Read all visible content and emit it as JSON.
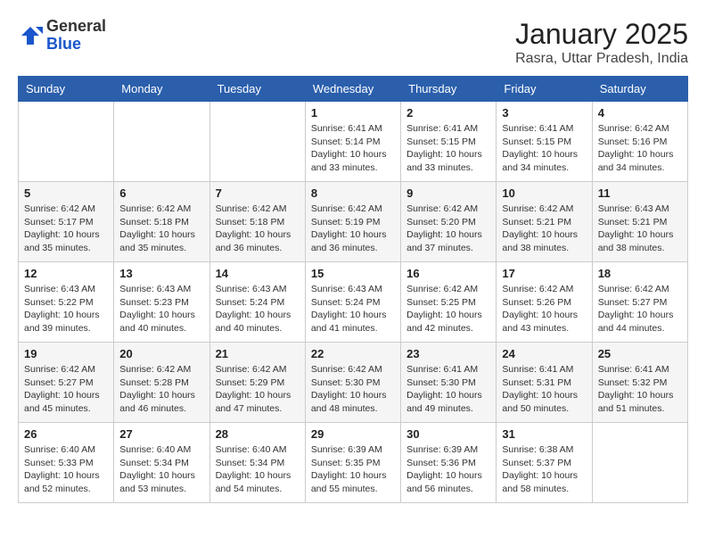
{
  "logo": {
    "general": "General",
    "blue": "Blue"
  },
  "header": {
    "month": "January 2025",
    "location": "Rasra, Uttar Pradesh, India"
  },
  "weekdays": [
    "Sunday",
    "Monday",
    "Tuesday",
    "Wednesday",
    "Thursday",
    "Friday",
    "Saturday"
  ],
  "weeks": [
    [
      {
        "day": "",
        "content": ""
      },
      {
        "day": "",
        "content": ""
      },
      {
        "day": "",
        "content": ""
      },
      {
        "day": "1",
        "content": "Sunrise: 6:41 AM\nSunset: 5:14 PM\nDaylight: 10 hours\nand 33 minutes."
      },
      {
        "day": "2",
        "content": "Sunrise: 6:41 AM\nSunset: 5:15 PM\nDaylight: 10 hours\nand 33 minutes."
      },
      {
        "day": "3",
        "content": "Sunrise: 6:41 AM\nSunset: 5:15 PM\nDaylight: 10 hours\nand 34 minutes."
      },
      {
        "day": "4",
        "content": "Sunrise: 6:42 AM\nSunset: 5:16 PM\nDaylight: 10 hours\nand 34 minutes."
      }
    ],
    [
      {
        "day": "5",
        "content": "Sunrise: 6:42 AM\nSunset: 5:17 PM\nDaylight: 10 hours\nand 35 minutes."
      },
      {
        "day": "6",
        "content": "Sunrise: 6:42 AM\nSunset: 5:18 PM\nDaylight: 10 hours\nand 35 minutes."
      },
      {
        "day": "7",
        "content": "Sunrise: 6:42 AM\nSunset: 5:18 PM\nDaylight: 10 hours\nand 36 minutes."
      },
      {
        "day": "8",
        "content": "Sunrise: 6:42 AM\nSunset: 5:19 PM\nDaylight: 10 hours\nand 36 minutes."
      },
      {
        "day": "9",
        "content": "Sunrise: 6:42 AM\nSunset: 5:20 PM\nDaylight: 10 hours\nand 37 minutes."
      },
      {
        "day": "10",
        "content": "Sunrise: 6:42 AM\nSunset: 5:21 PM\nDaylight: 10 hours\nand 38 minutes."
      },
      {
        "day": "11",
        "content": "Sunrise: 6:43 AM\nSunset: 5:21 PM\nDaylight: 10 hours\nand 38 minutes."
      }
    ],
    [
      {
        "day": "12",
        "content": "Sunrise: 6:43 AM\nSunset: 5:22 PM\nDaylight: 10 hours\nand 39 minutes."
      },
      {
        "day": "13",
        "content": "Sunrise: 6:43 AM\nSunset: 5:23 PM\nDaylight: 10 hours\nand 40 minutes."
      },
      {
        "day": "14",
        "content": "Sunrise: 6:43 AM\nSunset: 5:24 PM\nDaylight: 10 hours\nand 40 minutes."
      },
      {
        "day": "15",
        "content": "Sunrise: 6:43 AM\nSunset: 5:24 PM\nDaylight: 10 hours\nand 41 minutes."
      },
      {
        "day": "16",
        "content": "Sunrise: 6:42 AM\nSunset: 5:25 PM\nDaylight: 10 hours\nand 42 minutes."
      },
      {
        "day": "17",
        "content": "Sunrise: 6:42 AM\nSunset: 5:26 PM\nDaylight: 10 hours\nand 43 minutes."
      },
      {
        "day": "18",
        "content": "Sunrise: 6:42 AM\nSunset: 5:27 PM\nDaylight: 10 hours\nand 44 minutes."
      }
    ],
    [
      {
        "day": "19",
        "content": "Sunrise: 6:42 AM\nSunset: 5:27 PM\nDaylight: 10 hours\nand 45 minutes."
      },
      {
        "day": "20",
        "content": "Sunrise: 6:42 AM\nSunset: 5:28 PM\nDaylight: 10 hours\nand 46 minutes."
      },
      {
        "day": "21",
        "content": "Sunrise: 6:42 AM\nSunset: 5:29 PM\nDaylight: 10 hours\nand 47 minutes."
      },
      {
        "day": "22",
        "content": "Sunrise: 6:42 AM\nSunset: 5:30 PM\nDaylight: 10 hours\nand 48 minutes."
      },
      {
        "day": "23",
        "content": "Sunrise: 6:41 AM\nSunset: 5:30 PM\nDaylight: 10 hours\nand 49 minutes."
      },
      {
        "day": "24",
        "content": "Sunrise: 6:41 AM\nSunset: 5:31 PM\nDaylight: 10 hours\nand 50 minutes."
      },
      {
        "day": "25",
        "content": "Sunrise: 6:41 AM\nSunset: 5:32 PM\nDaylight: 10 hours\nand 51 minutes."
      }
    ],
    [
      {
        "day": "26",
        "content": "Sunrise: 6:40 AM\nSunset: 5:33 PM\nDaylight: 10 hours\nand 52 minutes."
      },
      {
        "day": "27",
        "content": "Sunrise: 6:40 AM\nSunset: 5:34 PM\nDaylight: 10 hours\nand 53 minutes."
      },
      {
        "day": "28",
        "content": "Sunrise: 6:40 AM\nSunset: 5:34 PM\nDaylight: 10 hours\nand 54 minutes."
      },
      {
        "day": "29",
        "content": "Sunrise: 6:39 AM\nSunset: 5:35 PM\nDaylight: 10 hours\nand 55 minutes."
      },
      {
        "day": "30",
        "content": "Sunrise: 6:39 AM\nSunset: 5:36 PM\nDaylight: 10 hours\nand 56 minutes."
      },
      {
        "day": "31",
        "content": "Sunrise: 6:38 AM\nSunset: 5:37 PM\nDaylight: 10 hours\nand 58 minutes."
      },
      {
        "day": "",
        "content": ""
      }
    ]
  ]
}
